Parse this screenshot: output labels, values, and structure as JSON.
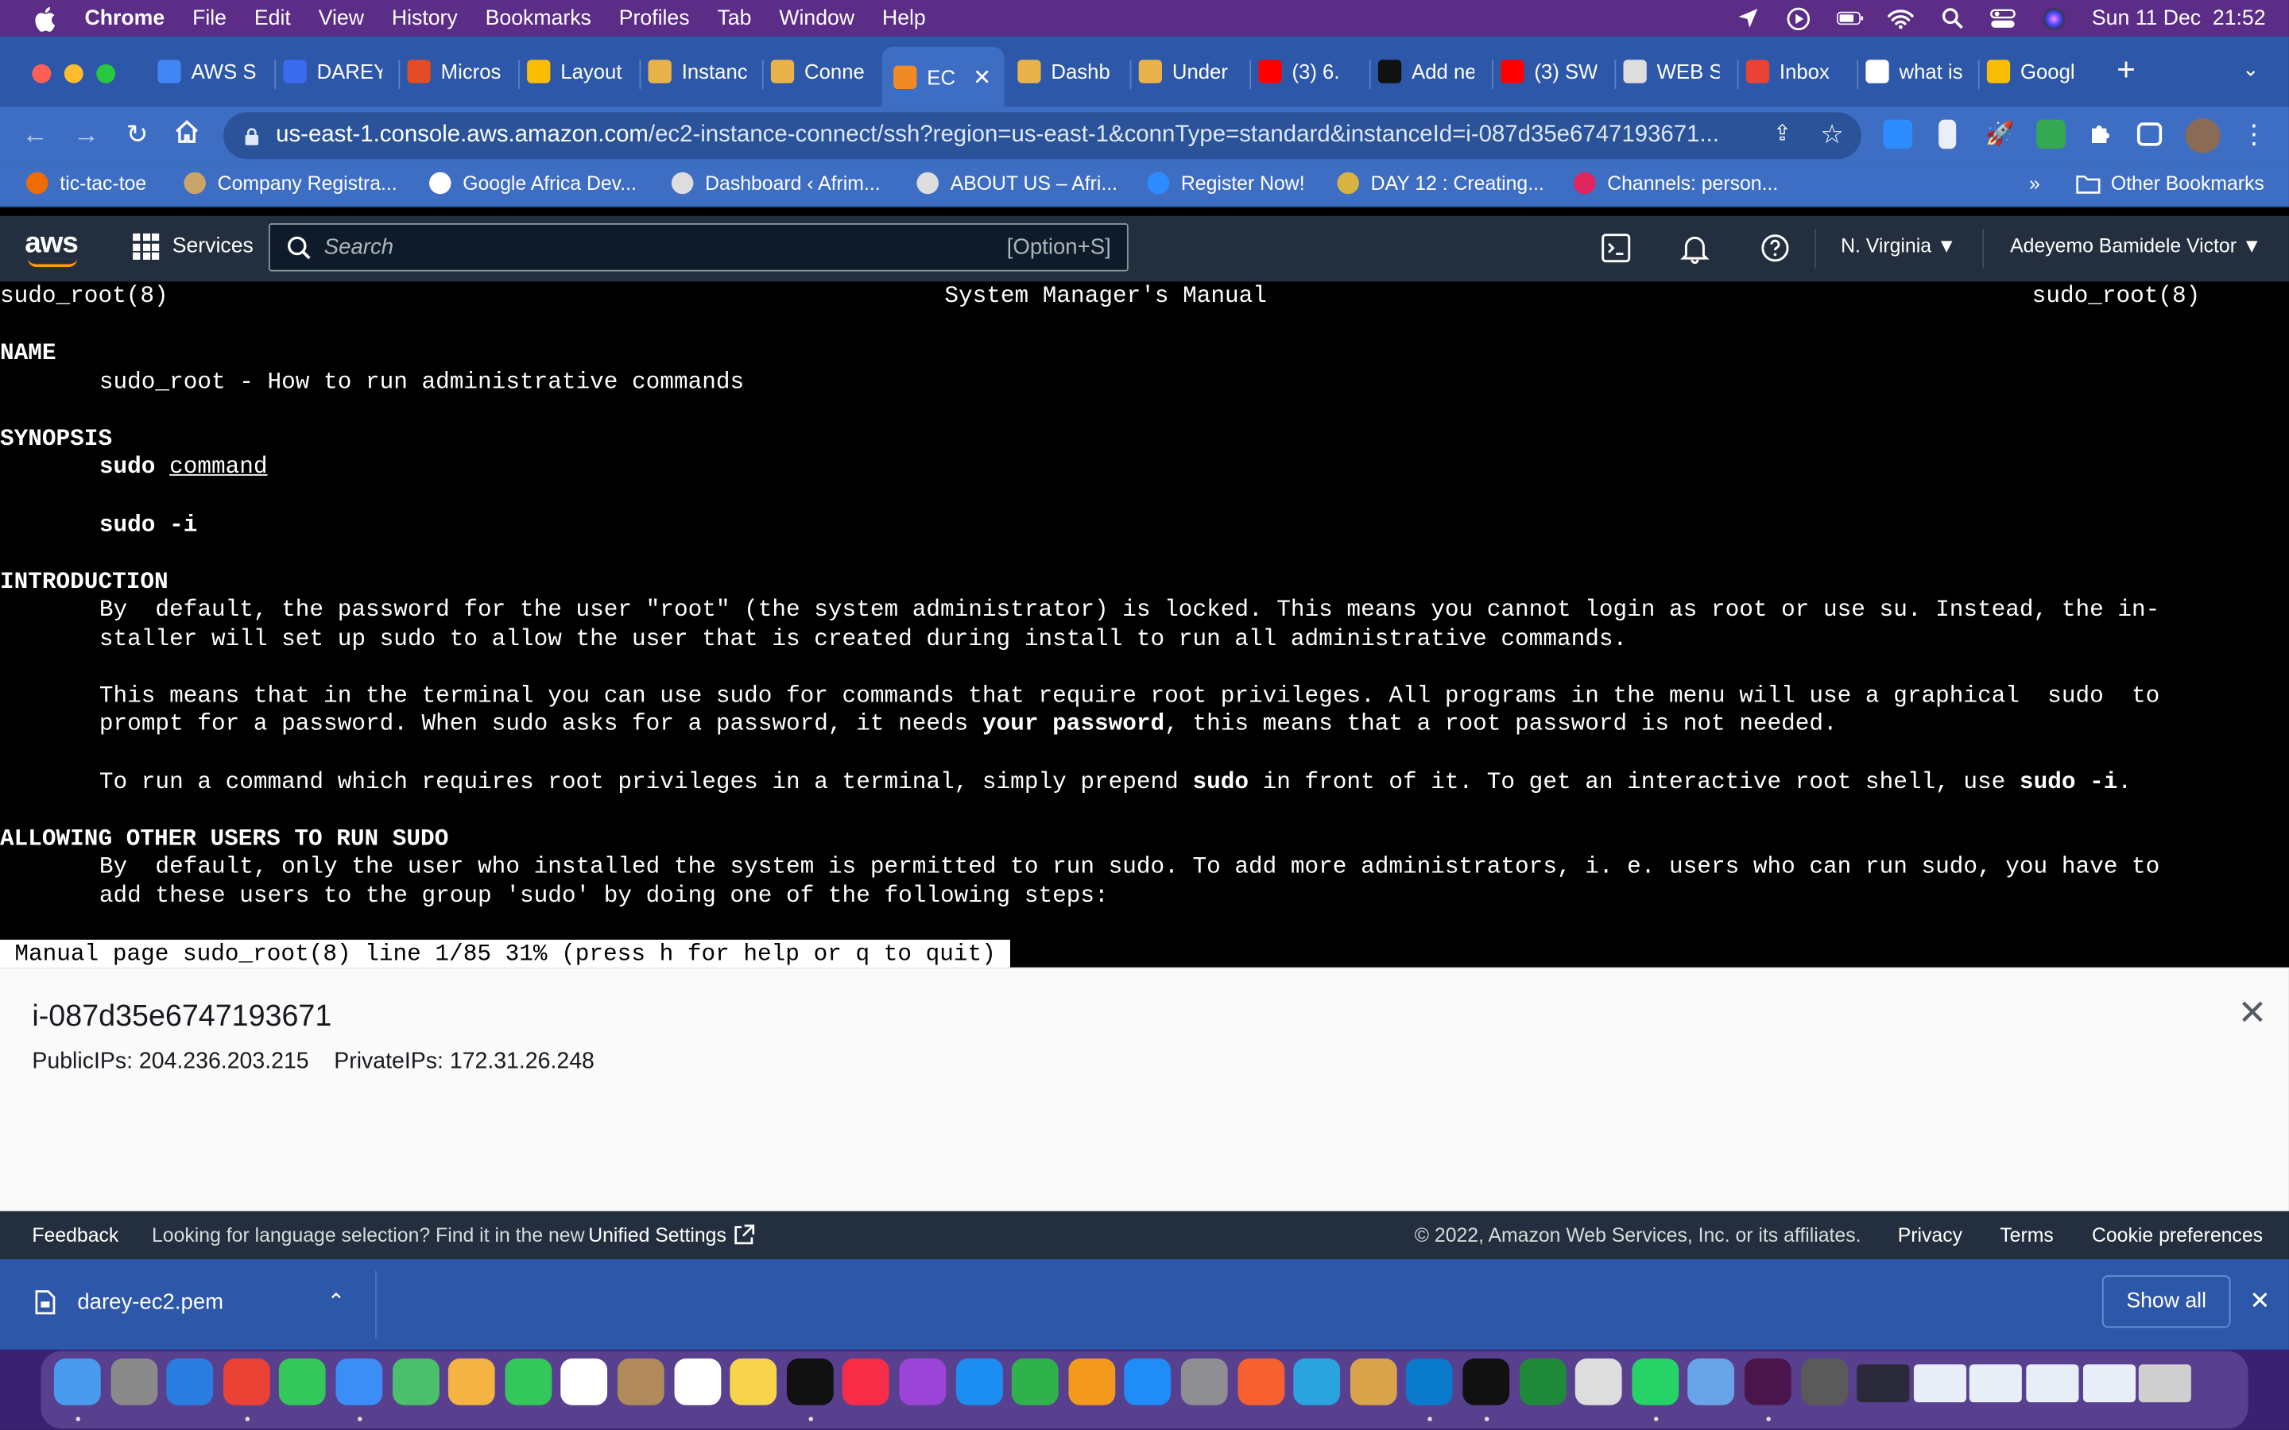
{
  "menubar": {
    "app": "Chrome",
    "items": [
      "File",
      "Edit",
      "View",
      "History",
      "Bookmarks",
      "Profiles",
      "Tab",
      "Window",
      "Help"
    ],
    "clock": "Sun 11 Dec  21:52"
  },
  "tabs": [
    {
      "label": "AWS S",
      "color": "#4285f4"
    },
    {
      "label": "DAREY",
      "color": "#3b6cf0"
    },
    {
      "label": "Micros",
      "color": "#e34c26"
    },
    {
      "label": "Layout",
      "color": "#fbbc04"
    },
    {
      "label": "Instanc",
      "color": "#e8b34a"
    },
    {
      "label": "Conne",
      "color": "#e8b34a"
    },
    {
      "label": "EC",
      "color": "#f08a24",
      "active": true
    },
    {
      "label": "Dashb",
      "color": "#e8b34a"
    },
    {
      "label": "Under",
      "color": "#e8b34a"
    },
    {
      "label": "(3) 6.",
      "color": "#ff0000"
    },
    {
      "label": "Add ne",
      "color": "#111111"
    },
    {
      "label": "(3) SW",
      "color": "#ff0000"
    },
    {
      "label": "WEB S",
      "color": "#dddddd"
    },
    {
      "label": "Inbox",
      "color": "#ea4335"
    },
    {
      "label": "what is",
      "color": "#ffffff"
    },
    {
      "label": "Googl",
      "color": "#fbbc04"
    }
  ],
  "address": {
    "host": "us-east-1.console.aws.amazon.com",
    "path": "/ec2-instance-connect/ssh?region=us-east-1&connType=standard&instanceId=i-087d35e6747193671..."
  },
  "bookmarks": [
    {
      "label": "tic-tac-toe",
      "color": "#ef6c00"
    },
    {
      "label": "Company Registra...",
      "color": "#c9a56a"
    },
    {
      "label": "Google Africa Dev...",
      "color": "#ffffff"
    },
    {
      "label": "Dashboard ‹ Afrim...",
      "color": "#dddddd"
    },
    {
      "label": "ABOUT US – Afri...",
      "color": "#dddddd"
    },
    {
      "label": "Register Now!",
      "color": "#2d8cff"
    },
    {
      "label": "DAY 12 : Creating...",
      "color": "#d9b341"
    },
    {
      "label": "Channels: person...",
      "color": "#e0245e"
    }
  ],
  "bookmarks_more": "»",
  "other_bookmarks": "Other Bookmarks",
  "aws": {
    "logo": "aws",
    "services": "Services",
    "search_placeholder": "Search",
    "search_shortcut": "[Option+S]",
    "region": "N. Virginia ▼",
    "user": "Adeyemo Bamidele Victor ▼"
  },
  "terminal": {
    "header_left": "sudo_root(8)",
    "header_center": "System Manager's Manual",
    "header_right": "sudo_root(8)",
    "name_heading": "NAME",
    "name_line": "sudo_root - How to run administrative commands",
    "synopsis_heading": "SYNOPSIS",
    "syn_cmd1": "sudo",
    "syn_arg1": "command",
    "syn_cmd2": "sudo -i",
    "intro_heading": "INTRODUCTION",
    "intro_1a": "By  default, the password for the user \"root\" (the system administrator) is locked. This means you cannot login as root or use su. Instead, the in-",
    "intro_1b": "staller will set up sudo to allow the user that is created during install to run all administrative commands.",
    "intro_2a": "This means that in the terminal you can use sudo for commands that require root privileges. All programs in the menu will use a graphical  sudo  to",
    "intro_2b_pre": "prompt for a password. When sudo asks for a password, it needs ",
    "intro_2b_bold": "your password",
    "intro_2b_post": ", this means that a root password is not needed.",
    "intro_3_pre": "To run a command which requires root privileges in a terminal, simply prepend ",
    "intro_3_b1": "sudo",
    "intro_3_mid": " in front of it. To get an interactive root shell, use ",
    "intro_3_b2": "sudo -i",
    "intro_3_end": ".",
    "allow_heading": "ALLOWING OTHER USERS TO RUN SUDO",
    "allow_1a": "By  default, only the user who installed the system is permitted to run sudo. To add more administrators, i. e. users who can run sudo, you have to",
    "allow_1b": "add these users to the group 'sudo' by doing one of the following steps:",
    "status": "Manual page sudo_root(8) line 1/85 31% (press h for help or q to quit)"
  },
  "instance": {
    "id": "i-087d35e6747193671",
    "ips": "PublicIPs: 204.236.203.215    PrivateIPs: 172.31.26.248"
  },
  "footer": {
    "feedback": "Feedback",
    "lang_msg": "Looking for language selection? Find it in the new",
    "unified": "Unified Settings",
    "copyright": "© 2022, Amazon Web Services, Inc. or its affiliates.",
    "privacy": "Privacy",
    "terms": "Terms",
    "cookies": "Cookie preferences"
  },
  "downloads": {
    "file": "darey-ec2.pem",
    "show_all": "Show all"
  },
  "dock_icons": [
    "finder",
    "launchpad",
    "safari",
    "chrome",
    "messages",
    "mail",
    "maps",
    "photos",
    "facetime",
    "calendar",
    "contacts",
    "reminders",
    "notes",
    "apple-tv",
    "music",
    "podcasts",
    "keynote",
    "numbers",
    "pages",
    "app-store",
    "system-preferences",
    "sketch",
    "telegram",
    "sketch-tool",
    "vscode",
    "terminal",
    "mongodb",
    "pen",
    "whatsapp",
    "preview",
    "slack",
    "screenshot",
    "window1",
    "window2",
    "window3",
    "window4",
    "window5",
    "trash"
  ],
  "colors": {
    "menubar": "#5b2d86",
    "chrome_frame": "#2d57a8",
    "aws_nav": "#232f3e",
    "terminal_bg": "#000000"
  }
}
